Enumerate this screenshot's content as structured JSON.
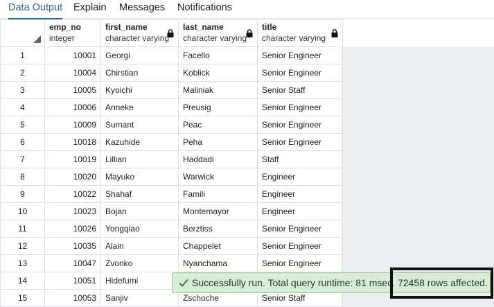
{
  "tabs": [
    {
      "label": "Data Output",
      "active": true
    },
    {
      "label": "Explain",
      "active": false
    },
    {
      "label": "Messages",
      "active": false
    },
    {
      "label": "Notifications",
      "active": false
    }
  ],
  "columns": [
    {
      "name": "emp_no",
      "type": "integer",
      "locked": false
    },
    {
      "name": "first_name",
      "type": "character varying",
      "locked": true
    },
    {
      "name": "last_name",
      "type": "character varying",
      "locked": true
    },
    {
      "name": "title",
      "type": "character varying",
      "locked": true
    }
  ],
  "rows": [
    {
      "num": "1",
      "emp_no": "10001",
      "first_name": "Georgi",
      "last_name": "Facello",
      "title": "Senior Engineer"
    },
    {
      "num": "2",
      "emp_no": "10004",
      "first_name": "Chirstian",
      "last_name": "Koblick",
      "title": "Senior Engineer"
    },
    {
      "num": "3",
      "emp_no": "10005",
      "first_name": "Kyoichi",
      "last_name": "Maliniak",
      "title": "Senior Staff"
    },
    {
      "num": "4",
      "emp_no": "10006",
      "first_name": "Anneke",
      "last_name": "Preusig",
      "title": "Senior Engineer"
    },
    {
      "num": "5",
      "emp_no": "10009",
      "first_name": "Sumant",
      "last_name": "Peac",
      "title": "Senior Engineer"
    },
    {
      "num": "6",
      "emp_no": "10018",
      "first_name": "Kazuhide",
      "last_name": "Peha",
      "title": "Senior Engineer"
    },
    {
      "num": "7",
      "emp_no": "10019",
      "first_name": "Lillian",
      "last_name": "Haddadi",
      "title": "Staff"
    },
    {
      "num": "8",
      "emp_no": "10020",
      "first_name": "Mayuko",
      "last_name": "Warwick",
      "title": "Engineer"
    },
    {
      "num": "9",
      "emp_no": "10022",
      "first_name": "Shahaf",
      "last_name": "Famili",
      "title": "Engineer"
    },
    {
      "num": "10",
      "emp_no": "10023",
      "first_name": "Bojan",
      "last_name": "Montemayor",
      "title": "Engineer"
    },
    {
      "num": "11",
      "emp_no": "10026",
      "first_name": "Yongqiao",
      "last_name": "Berztiss",
      "title": "Senior Engineer"
    },
    {
      "num": "12",
      "emp_no": "10035",
      "first_name": "Alain",
      "last_name": "Chappelet",
      "title": "Senior Engineer"
    },
    {
      "num": "13",
      "emp_no": "10047",
      "first_name": "Zvonko",
      "last_name": "Nyanchama",
      "title": "Senior Engineer"
    },
    {
      "num": "14",
      "emp_no": "10051",
      "first_name": "Hidefumi",
      "last_name": "",
      "title": ""
    },
    {
      "num": "15",
      "emp_no": "10053",
      "first_name": "Sanjiv",
      "last_name": "Zschoche",
      "title": "Senior Staff"
    }
  ],
  "toast": {
    "message": "Successfully run. Total query runtime: 81 msec. 72458 rows affected.",
    "icon": "check-icon"
  },
  "colors": {
    "active_tab": "#326690",
    "toast_bg": "#d8ecd7",
    "toast_border": "#8fcf8a",
    "grid_border": "#dde0e6"
  }
}
